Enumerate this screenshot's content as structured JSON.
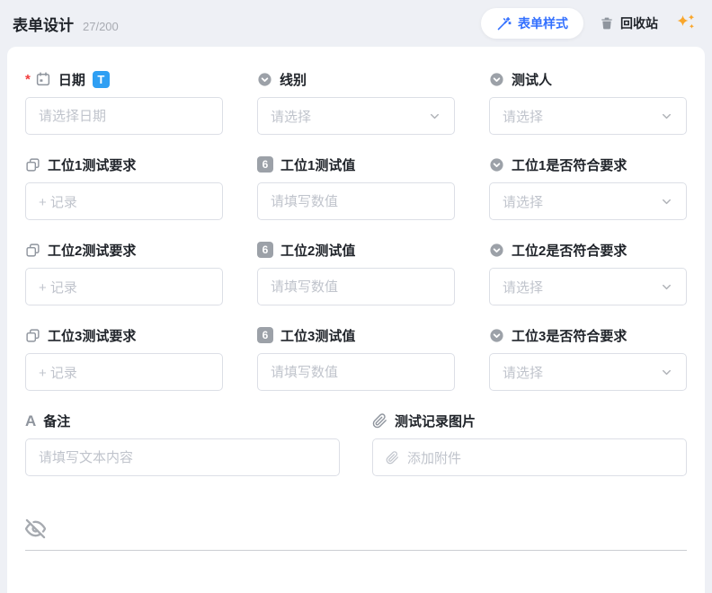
{
  "header": {
    "title": "表单设计",
    "count": "27/200",
    "style_button_label": "表单样式",
    "recycle_label": "回收站"
  },
  "colors": {
    "accent_blue": "#3370ff",
    "title_badge_blue": "#2f9ff3",
    "sparkle_orange": "#f9a62b",
    "required_red": "#f23c3c",
    "page_background": "#eef0f5",
    "card_background": "#ffffff"
  },
  "fields": [
    {
      "label": "日期",
      "icon": "calendar-icon",
      "required": true,
      "badge": "T",
      "control": "date",
      "placeholder": "请选择日期"
    },
    {
      "label": "线别",
      "icon": "select-icon",
      "control": "select",
      "placeholder": "请选择"
    },
    {
      "label": "测试人",
      "icon": "select-icon",
      "control": "select",
      "placeholder": "请选择"
    },
    {
      "label": "工位1测试要求",
      "icon": "linked-record-icon",
      "control": "record",
      "placeholder": "+ 记录"
    },
    {
      "label": "工位1测试值",
      "icon": "number-icon",
      "icon_glyph": "6",
      "control": "number",
      "placeholder": "请填写数值"
    },
    {
      "label": "工位1是否符合要求",
      "icon": "select-icon",
      "control": "select",
      "placeholder": "请选择"
    },
    {
      "label": "工位2测试要求",
      "icon": "linked-record-icon",
      "control": "record",
      "placeholder": "+ 记录"
    },
    {
      "label": "工位2测试值",
      "icon": "number-icon",
      "icon_glyph": "6",
      "control": "number",
      "placeholder": "请填写数值"
    },
    {
      "label": "工位2是否符合要求",
      "icon": "select-icon",
      "control": "select",
      "placeholder": "请选择"
    },
    {
      "label": "工位3测试要求",
      "icon": "linked-record-icon",
      "control": "record",
      "placeholder": "+ 记录"
    },
    {
      "label": "工位3测试值",
      "icon": "number-icon",
      "icon_glyph": "6",
      "control": "number",
      "placeholder": "请填写数值"
    },
    {
      "label": "工位3是否符合要求",
      "icon": "select-icon",
      "control": "select",
      "placeholder": "请选择"
    }
  ],
  "wide_fields": [
    {
      "label": "备注",
      "icon": "text-icon",
      "icon_glyph": "A",
      "control": "text",
      "placeholder": "请填写文本内容"
    },
    {
      "label": "测试记录图片",
      "icon": "attachment-icon",
      "control": "attachment",
      "placeholder": "添加附件"
    }
  ]
}
